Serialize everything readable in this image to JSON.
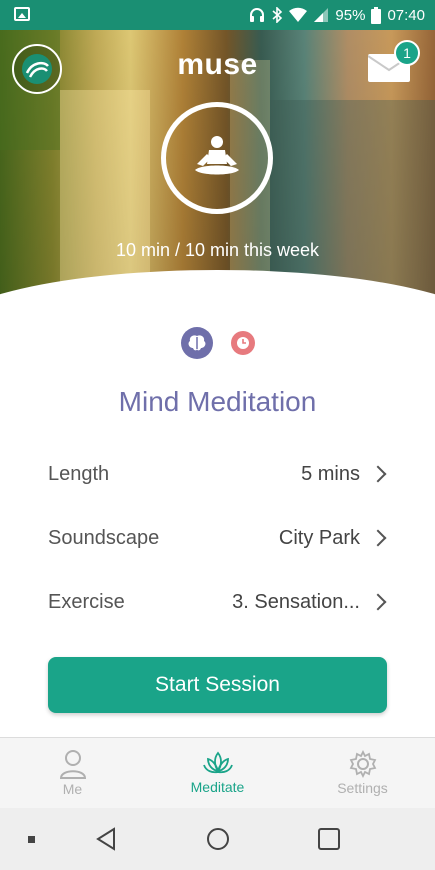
{
  "status_bar": {
    "battery": "95%",
    "time": "07:40"
  },
  "header": {
    "brand": "muse",
    "mail_badge": "1",
    "weekly_progress": "10 min / 10 min this week"
  },
  "session": {
    "title": "Mind Meditation",
    "settings": [
      {
        "label": "Length",
        "value": "5 mins"
      },
      {
        "label": "Soundscape",
        "value": "City Park"
      },
      {
        "label": "Exercise",
        "value": "3. Sensation..."
      }
    ],
    "start_label": "Start Session"
  },
  "tabs": [
    {
      "label": "Me",
      "icon": "person-icon",
      "active": false
    },
    {
      "label": "Meditate",
      "icon": "lotus-icon",
      "active": true
    },
    {
      "label": "Settings",
      "icon": "gear-icon",
      "active": false
    }
  ],
  "colors": {
    "accent": "#1aa489",
    "status_bar": "#1a8f73",
    "title": "#6f6faa",
    "brain_badge": "#6f6faa",
    "clock_badge": "#e77a7e"
  }
}
